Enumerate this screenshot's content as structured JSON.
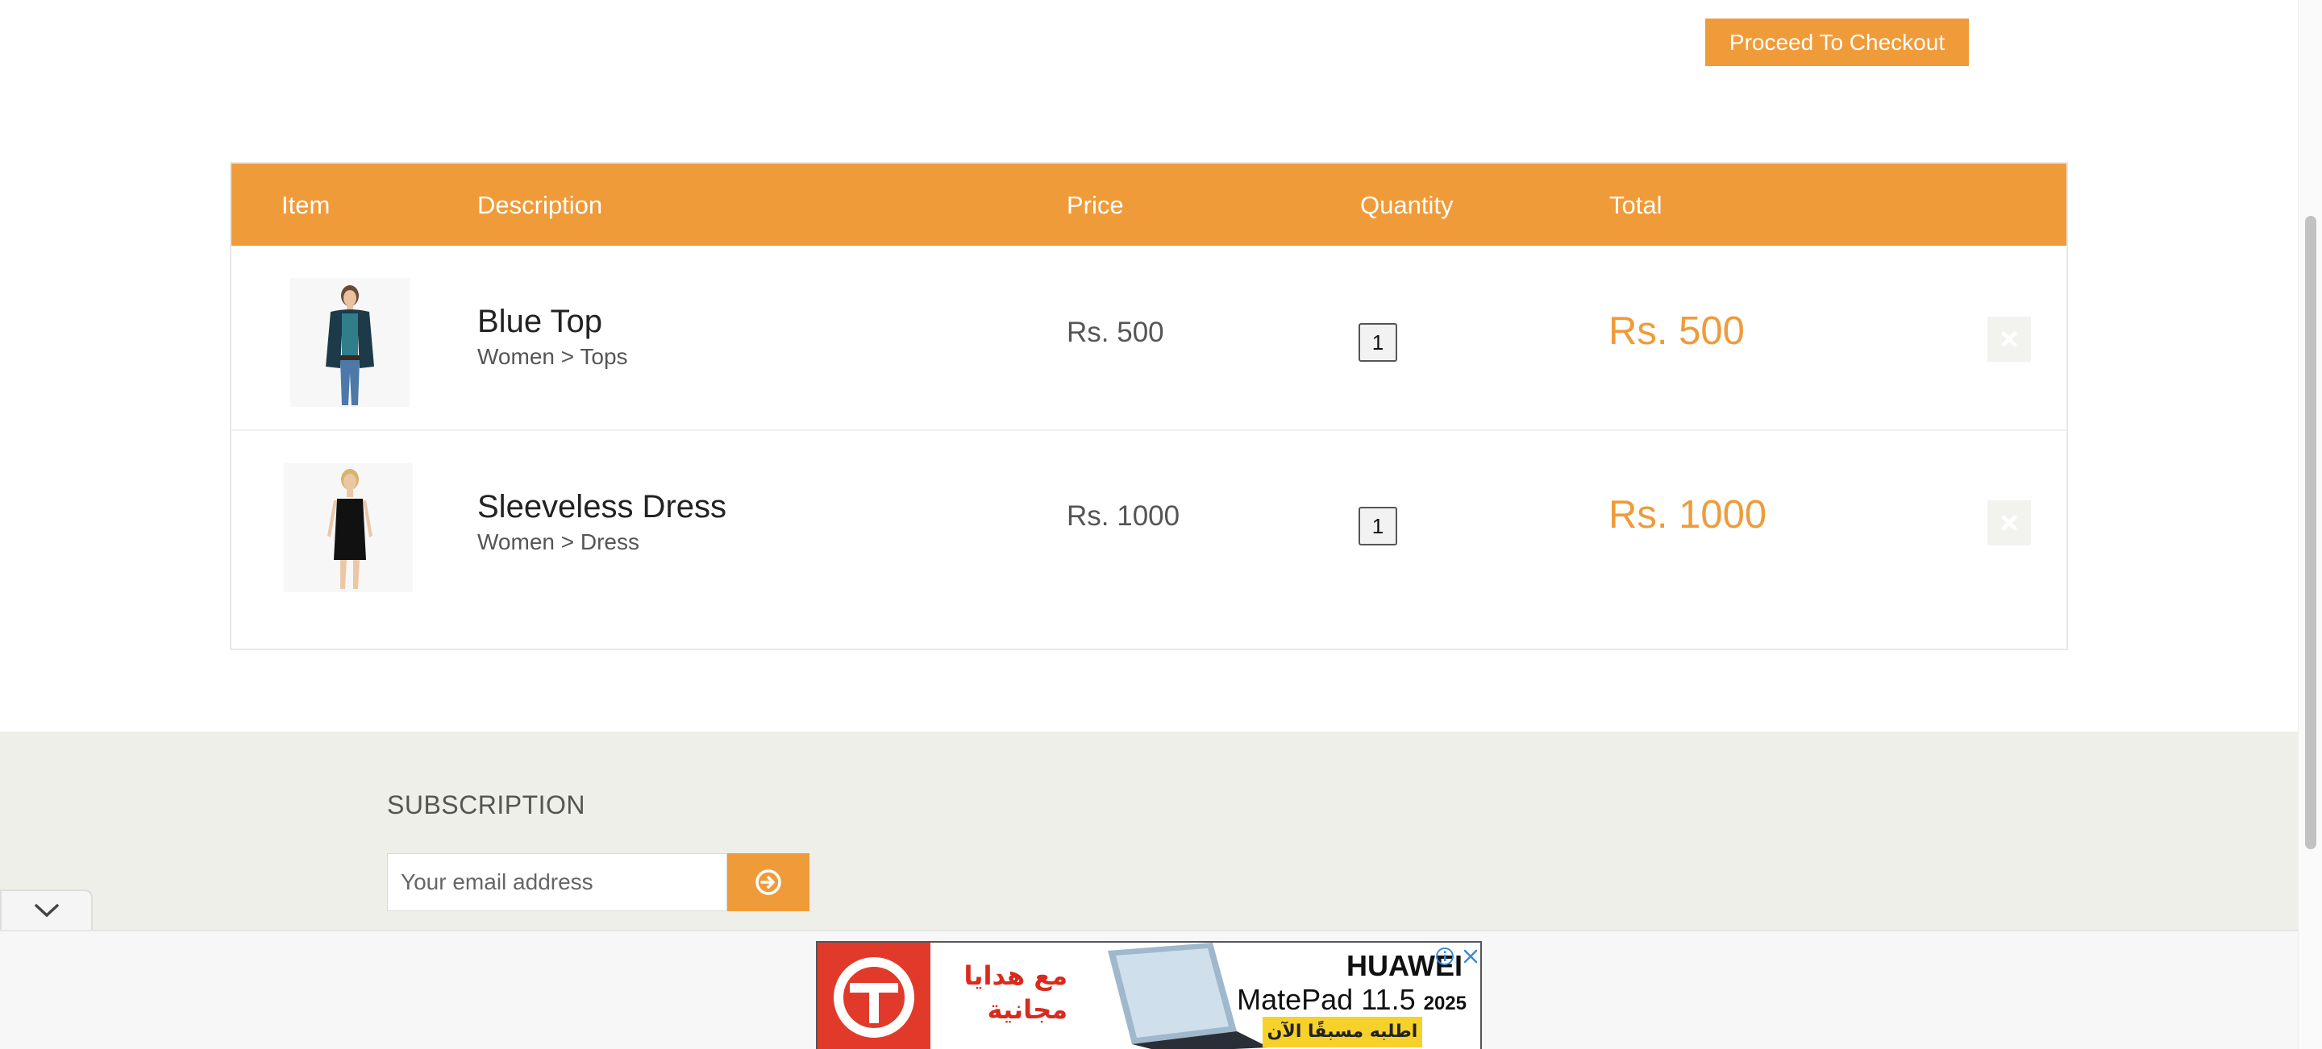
{
  "header": {
    "checkout_label": "Proceed To Checkout"
  },
  "cart": {
    "columns": {
      "item": "Item",
      "description": "Description",
      "price": "Price",
      "quantity": "Quantity",
      "total": "Total"
    },
    "items": [
      {
        "name": "Blue Top",
        "category": "Women > Tops",
        "price": "Rs. 500",
        "quantity": "1",
        "total": "Rs. 500"
      },
      {
        "name": "Sleeveless Dress",
        "category": "Women > Dress",
        "price": "Rs. 1000",
        "quantity": "1",
        "total": "Rs. 1000"
      }
    ]
  },
  "footer": {
    "subscription_title": "SUBSCRIPTION",
    "email_placeholder": "Your email address"
  },
  "ad": {
    "arabic_text": "مع هدايا مجانية",
    "brand": "HUAWEI",
    "model": "MatePad 11.5",
    "year": "2025",
    "cta": "اطلبه مسبقًا الآن"
  },
  "colors": {
    "accent": "#f09b39",
    "footer_bg": "#efefe9",
    "ad_red": "#e23a2a",
    "ad_yellow": "#f5d12a"
  },
  "icons": [
    "close-icon",
    "arrow-circle-right-icon",
    "chevron-down-icon",
    "info-icon",
    "huawei-logo-icon"
  ]
}
